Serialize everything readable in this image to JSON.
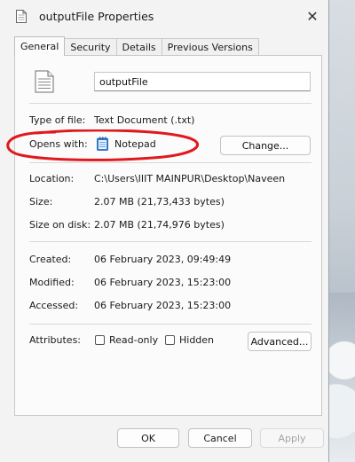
{
  "title": "outputFile Properties",
  "tabs": [
    {
      "label": "General",
      "active": true
    },
    {
      "label": "Security"
    },
    {
      "label": "Details"
    },
    {
      "label": "Previous Versions"
    }
  ],
  "file_name": "outputFile",
  "type_of_file": {
    "label": "Type of file:",
    "value": "Text Document (.txt)"
  },
  "opens_with": {
    "label": "Opens with:",
    "value": "Notepad",
    "button": "Change..."
  },
  "location": {
    "label": "Location:",
    "value": "C:\\Users\\IIIT MAINPUR\\Desktop\\Naveen"
  },
  "size": {
    "label": "Size:",
    "value": "2.07 MB (21,73,433 bytes)"
  },
  "size_on_disk": {
    "label": "Size on disk:",
    "value": "2.07 MB (21,74,976 bytes)"
  },
  "created": {
    "label": "Created:",
    "value": "06 February 2023, 09:49:49"
  },
  "modified": {
    "label": "Modified:",
    "value": "06 February 2023, 15:23:00"
  },
  "accessed": {
    "label": "Accessed:",
    "value": "06 February 2023, 15:23:00"
  },
  "attributes": {
    "label": "Attributes:",
    "read_only": "Read-only",
    "hidden": "Hidden",
    "advanced": "Advanced..."
  },
  "footer": {
    "ok": "OK",
    "cancel": "Cancel",
    "apply": "Apply"
  },
  "icons": {
    "title": "text-file-icon",
    "file": "text-file-icon",
    "notepad": "notepad-icon",
    "close": "close-icon"
  },
  "colors": {
    "annotation": "#e0191e",
    "window_bg": "#f3f3f3",
    "panel_bg": "#fbfbfb"
  }
}
